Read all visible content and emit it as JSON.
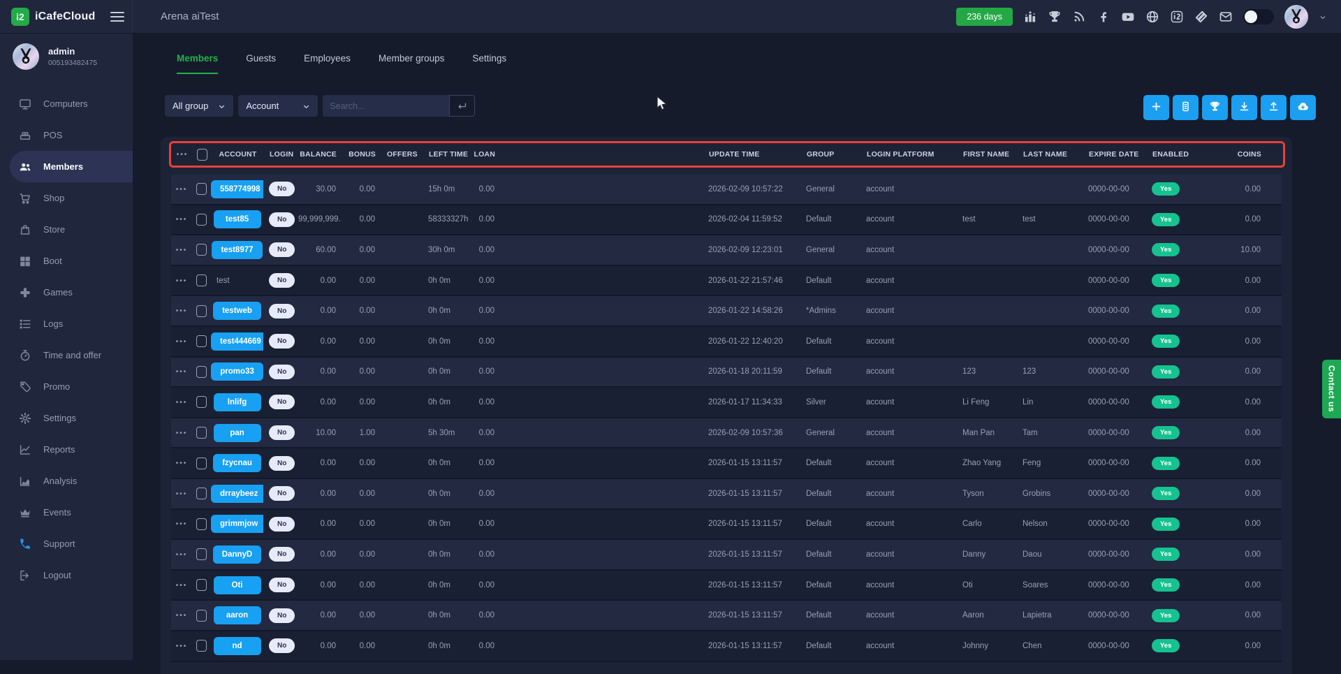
{
  "topbar": {
    "brand": "iCafeCloud",
    "brand_glyph": "i2",
    "title": "Arena aiTest",
    "days_badge": "236 days",
    "icons": [
      "ranking-icon",
      "trophy-icon",
      "rss-icon",
      "facebook-icon",
      "youtube-icon",
      "globe-icon",
      "i2-brand-icon",
      "layers-icon",
      "mail-icon"
    ]
  },
  "user": {
    "name": "admin",
    "id": "005193482475"
  },
  "sidebar": {
    "items": [
      {
        "label": "Computers",
        "icon": "monitor-icon"
      },
      {
        "label": "POS",
        "icon": "pos-icon"
      },
      {
        "label": "Members",
        "icon": "members-icon",
        "active": true
      },
      {
        "label": "Shop",
        "icon": "cart-icon"
      },
      {
        "label": "Store",
        "icon": "bag-icon"
      },
      {
        "label": "Boot",
        "icon": "windows-icon"
      },
      {
        "label": "Games",
        "icon": "gamepad-icon"
      },
      {
        "label": "Logs",
        "icon": "list-icon"
      },
      {
        "label": "Time and offer",
        "icon": "stopwatch-icon"
      },
      {
        "label": "Promo",
        "icon": "tag-icon"
      },
      {
        "label": "Settings",
        "icon": "gear-icon"
      },
      {
        "label": "Reports",
        "icon": "line-chart-icon"
      },
      {
        "label": "Analysis",
        "icon": "area-chart-icon"
      },
      {
        "label": "Events",
        "icon": "crown-icon"
      },
      {
        "label": "Support",
        "icon": "phone-icon",
        "support": true
      },
      {
        "label": "Logout",
        "icon": "logout-icon"
      }
    ]
  },
  "tabs": [
    {
      "label": "Members",
      "active": true
    },
    {
      "label": "Guests"
    },
    {
      "label": "Employees"
    },
    {
      "label": "Member groups"
    },
    {
      "label": "Settings"
    }
  ],
  "filters": {
    "group_select": "All group",
    "field_select": "Account",
    "search_placeholder": "Search..."
  },
  "actions": [
    "plus-icon",
    "card-icon",
    "trophy-icon",
    "download-icon",
    "upload-icon",
    "cloud-download-icon"
  ],
  "contact_us": "Contact us",
  "colors": {
    "accent_blue": "#18a0f2",
    "accent_green": "#23a845",
    "teal_green": "#16c28f",
    "annotation_red": "#e8403a"
  },
  "table": {
    "columns": {
      "account": "ACCOUNT",
      "login": "LOGIN",
      "balance": "BALANCE",
      "bonus": "BONUS",
      "offers": "OFFERS",
      "left_time": "LEFT TIME",
      "loan": "LOAN",
      "update_time": "UPDATE TIME",
      "group": "GROUP",
      "login_platform": "LOGIN PLATFORM",
      "first_name": "FIRST NAME",
      "last_name": "LAST NAME",
      "expire_date": "EXPIRE DATE",
      "enabled": "ENABLED",
      "coins": "COINS"
    },
    "rows": [
      {
        "account": "558774998",
        "button": true,
        "login": "No",
        "balance": "30.00",
        "bonus": "0.00",
        "offers": "",
        "left_time": "15h 0m",
        "loan": "0.00",
        "update_time": "2026-02-09 10:57:22",
        "group": "General",
        "login_platform": "account",
        "first_name": "",
        "last_name": "",
        "expire_date": "0000-00-00",
        "enabled": "Yes",
        "coins": "0.00"
      },
      {
        "account": "test85",
        "button": true,
        "login": "No",
        "balance": "99,999,999...",
        "bonus": "0.00",
        "offers": "",
        "left_time": "58333327h ...",
        "loan": "0.00",
        "update_time": "2026-02-04 11:59:52",
        "group": "Default",
        "login_platform": "account",
        "first_name": "test",
        "last_name": "test",
        "expire_date": "0000-00-00",
        "enabled": "Yes",
        "coins": "0.00"
      },
      {
        "account": "test8977",
        "button": true,
        "login": "No",
        "balance": "60.00",
        "bonus": "0.00",
        "offers": "",
        "left_time": "30h 0m",
        "loan": "0.00",
        "update_time": "2026-02-09 12:23:01",
        "group": "General",
        "login_platform": "account",
        "first_name": "",
        "last_name": "",
        "expire_date": "0000-00-00",
        "enabled": "Yes",
        "coins": "10.00"
      },
      {
        "account": "test",
        "button": false,
        "login": "No",
        "balance": "0.00",
        "bonus": "0.00",
        "offers": "",
        "left_time": "0h 0m",
        "loan": "0.00",
        "update_time": "2026-01-22 21:57:46",
        "group": "Default",
        "login_platform": "account",
        "first_name": "",
        "last_name": "",
        "expire_date": "0000-00-00",
        "enabled": "Yes",
        "coins": "0.00"
      },
      {
        "account": "testweb",
        "button": true,
        "login": "No",
        "balance": "0.00",
        "bonus": "0.00",
        "offers": "",
        "left_time": "0h 0m",
        "loan": "0.00",
        "update_time": "2026-01-22 14:58:26",
        "group": "*Admins",
        "login_platform": "account",
        "first_name": "",
        "last_name": "",
        "expire_date": "0000-00-00",
        "enabled": "Yes",
        "coins": "0.00"
      },
      {
        "account": "test444669",
        "button": true,
        "login": "No",
        "balance": "0.00",
        "bonus": "0.00",
        "offers": "",
        "left_time": "0h 0m",
        "loan": "0.00",
        "update_time": "2026-01-22 12:40:20",
        "group": "Default",
        "login_platform": "account",
        "first_name": "",
        "last_name": "",
        "expire_date": "0000-00-00",
        "enabled": "Yes",
        "coins": "0.00"
      },
      {
        "account": "promo33",
        "button": true,
        "login": "No",
        "balance": "0.00",
        "bonus": "0.00",
        "offers": "",
        "left_time": "0h 0m",
        "loan": "0.00",
        "update_time": "2026-01-18 20:11:59",
        "group": "Default",
        "login_platform": "account",
        "first_name": "123",
        "last_name": "123",
        "expire_date": "0000-00-00",
        "enabled": "Yes",
        "coins": "0.00"
      },
      {
        "account": "lnlifg",
        "button": true,
        "login": "No",
        "balance": "0.00",
        "bonus": "0.00",
        "offers": "",
        "left_time": "0h 0m",
        "loan": "0.00",
        "update_time": "2026-01-17 11:34:33",
        "group": "Silver",
        "login_platform": "account",
        "first_name": "Li Feng",
        "last_name": "Lin",
        "expire_date": "0000-00-00",
        "enabled": "Yes",
        "coins": "0.00"
      },
      {
        "account": "pan",
        "button": true,
        "login": "No",
        "balance": "10.00",
        "bonus": "1.00",
        "offers": "",
        "left_time": "5h 30m",
        "loan": "0.00",
        "update_time": "2026-02-09 10:57:36",
        "group": "General",
        "login_platform": "account",
        "first_name": "Man Pan",
        "last_name": "Tam",
        "expire_date": "0000-00-00",
        "enabled": "Yes",
        "coins": "0.00"
      },
      {
        "account": "fzycnau",
        "button": true,
        "login": "No",
        "balance": "0.00",
        "bonus": "0.00",
        "offers": "",
        "left_time": "0h 0m",
        "loan": "0.00",
        "update_time": "2026-01-15 13:11:57",
        "group": "Default",
        "login_platform": "account",
        "first_name": "Zhao Yang",
        "last_name": "Feng",
        "expire_date": "0000-00-00",
        "enabled": "Yes",
        "coins": "0.00"
      },
      {
        "account": "drraybeez",
        "button": true,
        "login": "No",
        "balance": "0.00",
        "bonus": "0.00",
        "offers": "",
        "left_time": "0h 0m",
        "loan": "0.00",
        "update_time": "2026-01-15 13:11:57",
        "group": "Default",
        "login_platform": "account",
        "first_name": "Tyson",
        "last_name": "Grobins",
        "expire_date": "0000-00-00",
        "enabled": "Yes",
        "coins": "0.00"
      },
      {
        "account": "grimmjow",
        "button": true,
        "login": "No",
        "balance": "0.00",
        "bonus": "0.00",
        "offers": "",
        "left_time": "0h 0m",
        "loan": "0.00",
        "update_time": "2026-01-15 13:11:57",
        "group": "Default",
        "login_platform": "account",
        "first_name": "Carlo",
        "last_name": "Nelson",
        "expire_date": "0000-00-00",
        "enabled": "Yes",
        "coins": "0.00"
      },
      {
        "account": "DannyD",
        "button": true,
        "login": "No",
        "balance": "0.00",
        "bonus": "0.00",
        "offers": "",
        "left_time": "0h 0m",
        "loan": "0.00",
        "update_time": "2026-01-15 13:11:57",
        "group": "Default",
        "login_platform": "account",
        "first_name": "Danny",
        "last_name": "Daou",
        "expire_date": "0000-00-00",
        "enabled": "Yes",
        "coins": "0.00"
      },
      {
        "account": "Oti",
        "button": true,
        "login": "No",
        "balance": "0.00",
        "bonus": "0.00",
        "offers": "",
        "left_time": "0h 0m",
        "loan": "0.00",
        "update_time": "2026-01-15 13:11:57",
        "group": "Default",
        "login_platform": "account",
        "first_name": "Oti",
        "last_name": "Soares",
        "expire_date": "0000-00-00",
        "enabled": "Yes",
        "coins": "0.00"
      },
      {
        "account": "aaron",
        "button": true,
        "login": "No",
        "balance": "0.00",
        "bonus": "0.00",
        "offers": "",
        "left_time": "0h 0m",
        "loan": "0.00",
        "update_time": "2026-01-15 13:11:57",
        "group": "Default",
        "login_platform": "account",
        "first_name": "Aaron",
        "last_name": "Lapietra",
        "expire_date": "0000-00-00",
        "enabled": "Yes",
        "coins": "0.00"
      },
      {
        "account": "nd",
        "button": true,
        "login": "No",
        "balance": "0.00",
        "bonus": "0.00",
        "offers": "",
        "left_time": "0h 0m",
        "loan": "0.00",
        "update_time": "2026-01-15 13:11:57",
        "group": "Default",
        "login_platform": "account",
        "first_name": "Johnny",
        "last_name": "Chen",
        "expire_date": "0000-00-00",
        "enabled": "Yes",
        "coins": "0.00"
      }
    ]
  }
}
